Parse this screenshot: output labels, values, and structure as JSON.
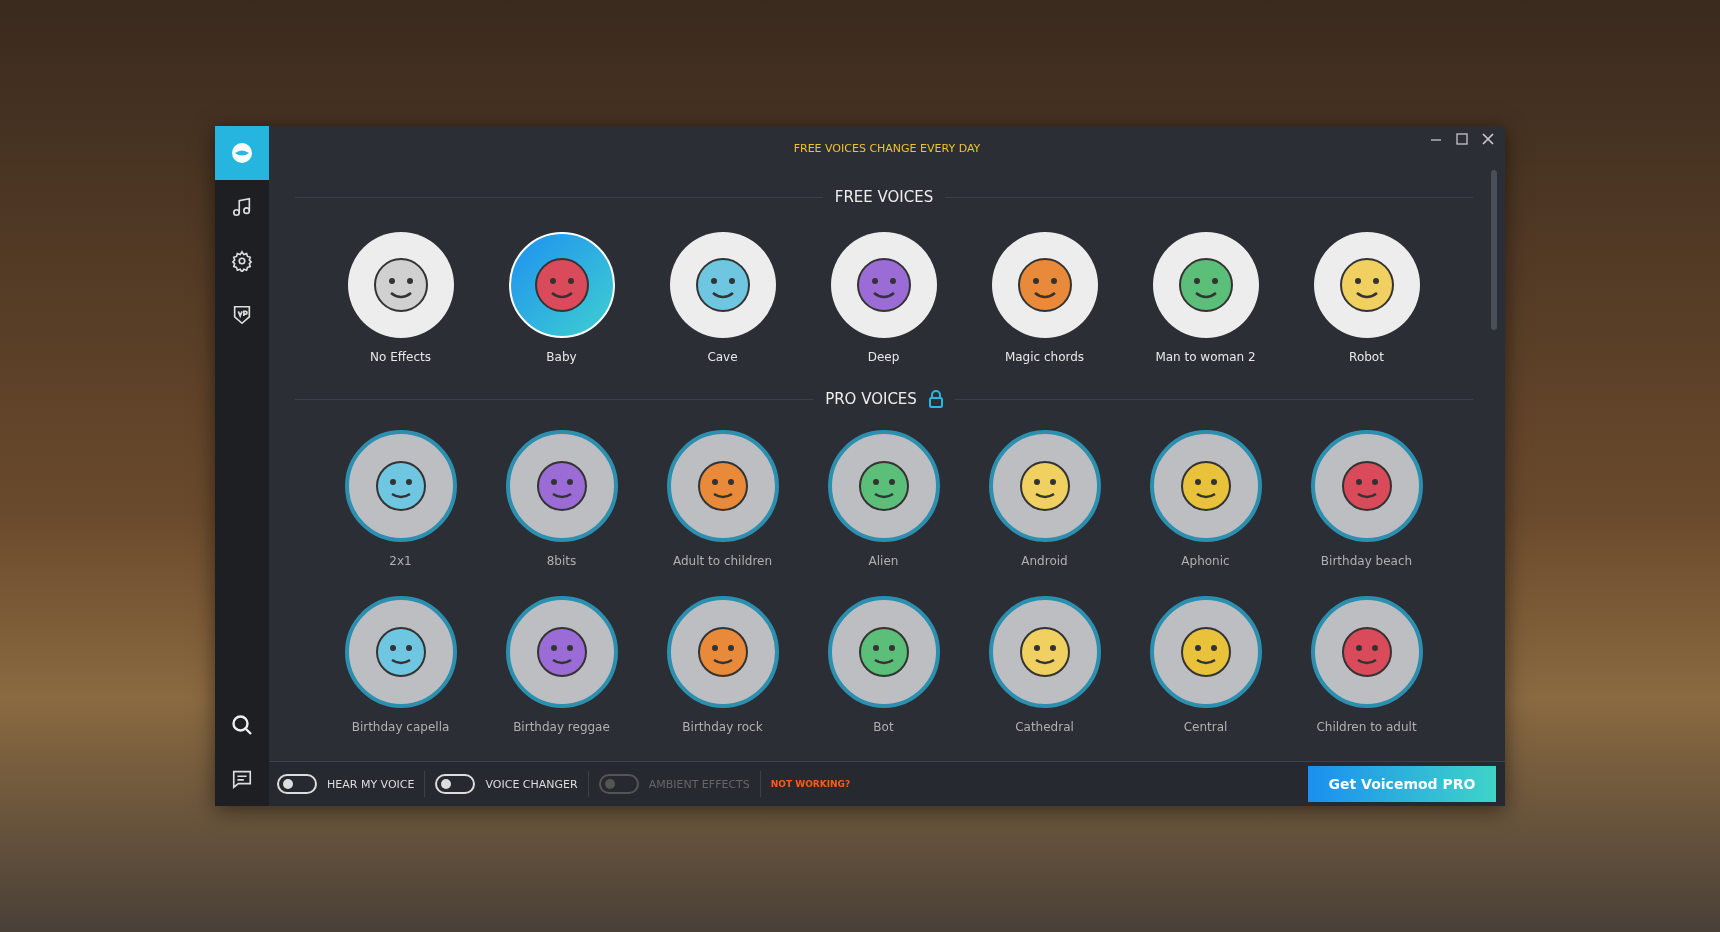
{
  "window": {
    "banner": "FREE VOICES CHANGE EVERY DAY"
  },
  "sidebar": {
    "items": [
      {
        "kind": "logo",
        "selected": true
      },
      {
        "kind": "music",
        "selected": false
      },
      {
        "kind": "settings",
        "selected": false
      },
      {
        "kind": "vp",
        "selected": false
      }
    ],
    "bottom_items": [
      {
        "kind": "search"
      },
      {
        "kind": "chat"
      }
    ]
  },
  "free_voices": {
    "title": "FREE VOICES",
    "voices": [
      {
        "name": "No Effects",
        "selected": false
      },
      {
        "name": "Baby",
        "selected": true
      },
      {
        "name": "Cave",
        "selected": false
      },
      {
        "name": "Deep",
        "selected": false
      },
      {
        "name": "Magic chords",
        "selected": false
      },
      {
        "name": "Man to woman 2",
        "selected": false
      },
      {
        "name": "Robot",
        "selected": false
      }
    ]
  },
  "pro_voices": {
    "title": "PRO VOICES",
    "locked": true,
    "voices": [
      {
        "name": "2x1"
      },
      {
        "name": "8bits"
      },
      {
        "name": "Adult to children"
      },
      {
        "name": "Alien"
      },
      {
        "name": "Android"
      },
      {
        "name": "Aphonic"
      },
      {
        "name": "Birthday beach"
      },
      {
        "name": "Birthday capella"
      },
      {
        "name": "Birthday reggae"
      },
      {
        "name": "Birthday rock"
      },
      {
        "name": "Bot"
      },
      {
        "name": "Cathedral"
      },
      {
        "name": "Central"
      },
      {
        "name": "Children to adult"
      }
    ]
  },
  "bottom_bar": {
    "toggles": [
      {
        "label": "HEAR MY VOICE",
        "on": false,
        "disabled": false
      },
      {
        "label": "VOICE CHANGER",
        "on": false,
        "disabled": false
      },
      {
        "label": "AMBIENT EFFECTS",
        "on": false,
        "disabled": true
      }
    ],
    "warning": "NOT WORKING?",
    "button": "Get Voicemod PRO"
  }
}
